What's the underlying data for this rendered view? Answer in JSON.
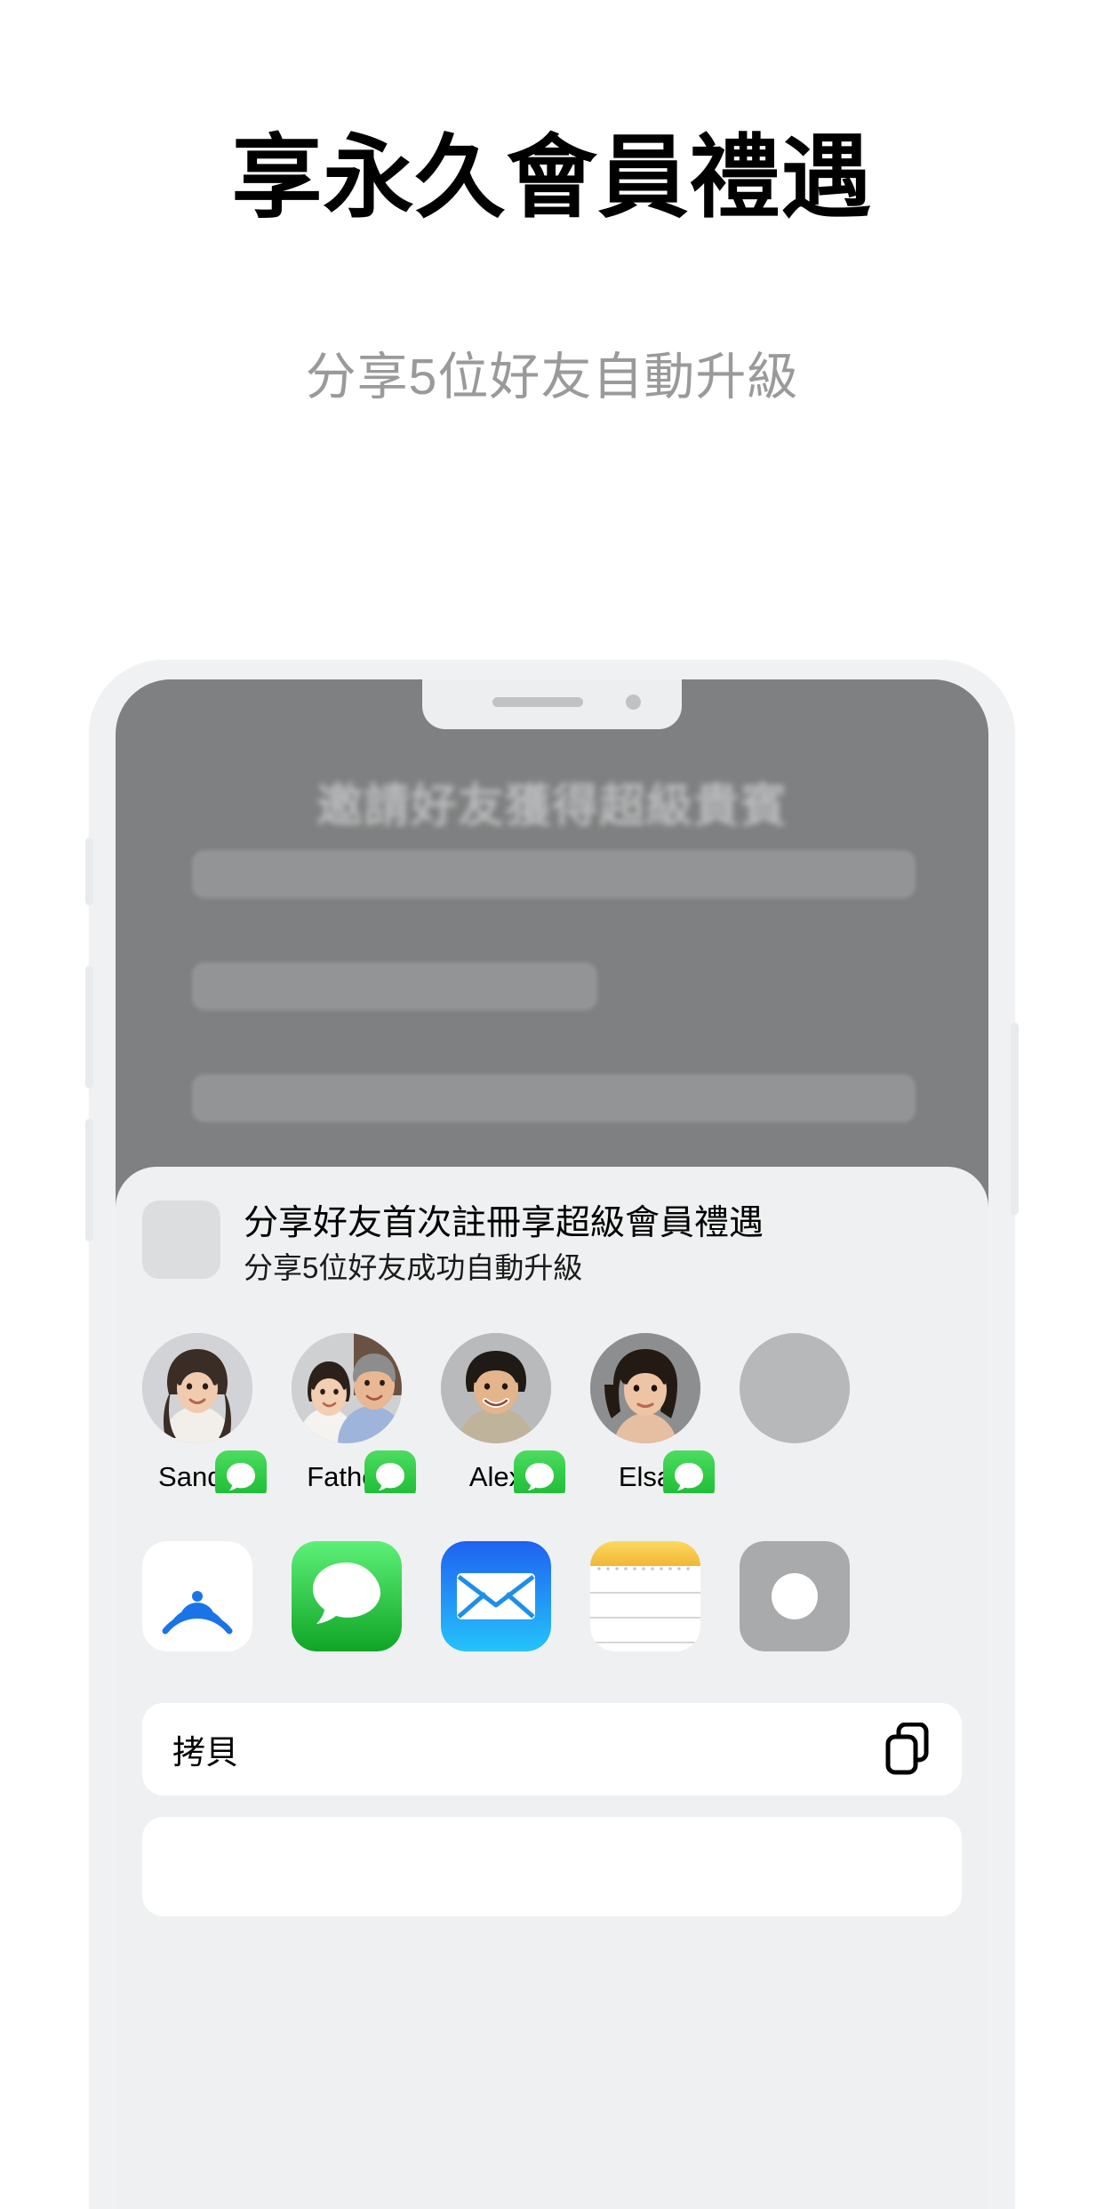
{
  "hero": {
    "title": "享永久會員禮遇",
    "subtitle": "分享5位好友自動升級"
  },
  "phone": {
    "background_app": {
      "title": "邀請好友獲得超級貴賓"
    },
    "share_sheet": {
      "header": {
        "title": "分享好友首次註冊享超級會員禮遇",
        "subtitle": "分享5位好友成功自動升級"
      },
      "contacts": [
        {
          "name": "Sandy",
          "badge": "imessage-icon"
        },
        {
          "name": "Father",
          "badge": "imessage-icon"
        },
        {
          "name": "Alex",
          "badge": "imessage-icon"
        },
        {
          "name": "Elsa",
          "badge": "imessage-icon"
        },
        {
          "name": "",
          "badge": ""
        }
      ],
      "apps": [
        {
          "name": "airdrop-icon"
        },
        {
          "name": "messages-icon"
        },
        {
          "name": "mail-icon"
        },
        {
          "name": "notes-icon"
        },
        {
          "name": "more-app-icon"
        }
      ],
      "actions": [
        {
          "label": "拷貝",
          "icon": "copy-icon"
        },
        {
          "label": "",
          "icon": ""
        }
      ]
    }
  },
  "colors": {
    "headline": "#000000",
    "subhead": "#9a9a9a",
    "phone_frame": "#f0f1f2",
    "screen_bg": "#7f8081",
    "sheet_bg": "#eff0f1",
    "imessage_green": "#2ecc40",
    "mail_blue": "#1d9bf6",
    "notes_yellow": "#f7cf4a",
    "airdrop_blue": "#1a74e8"
  }
}
